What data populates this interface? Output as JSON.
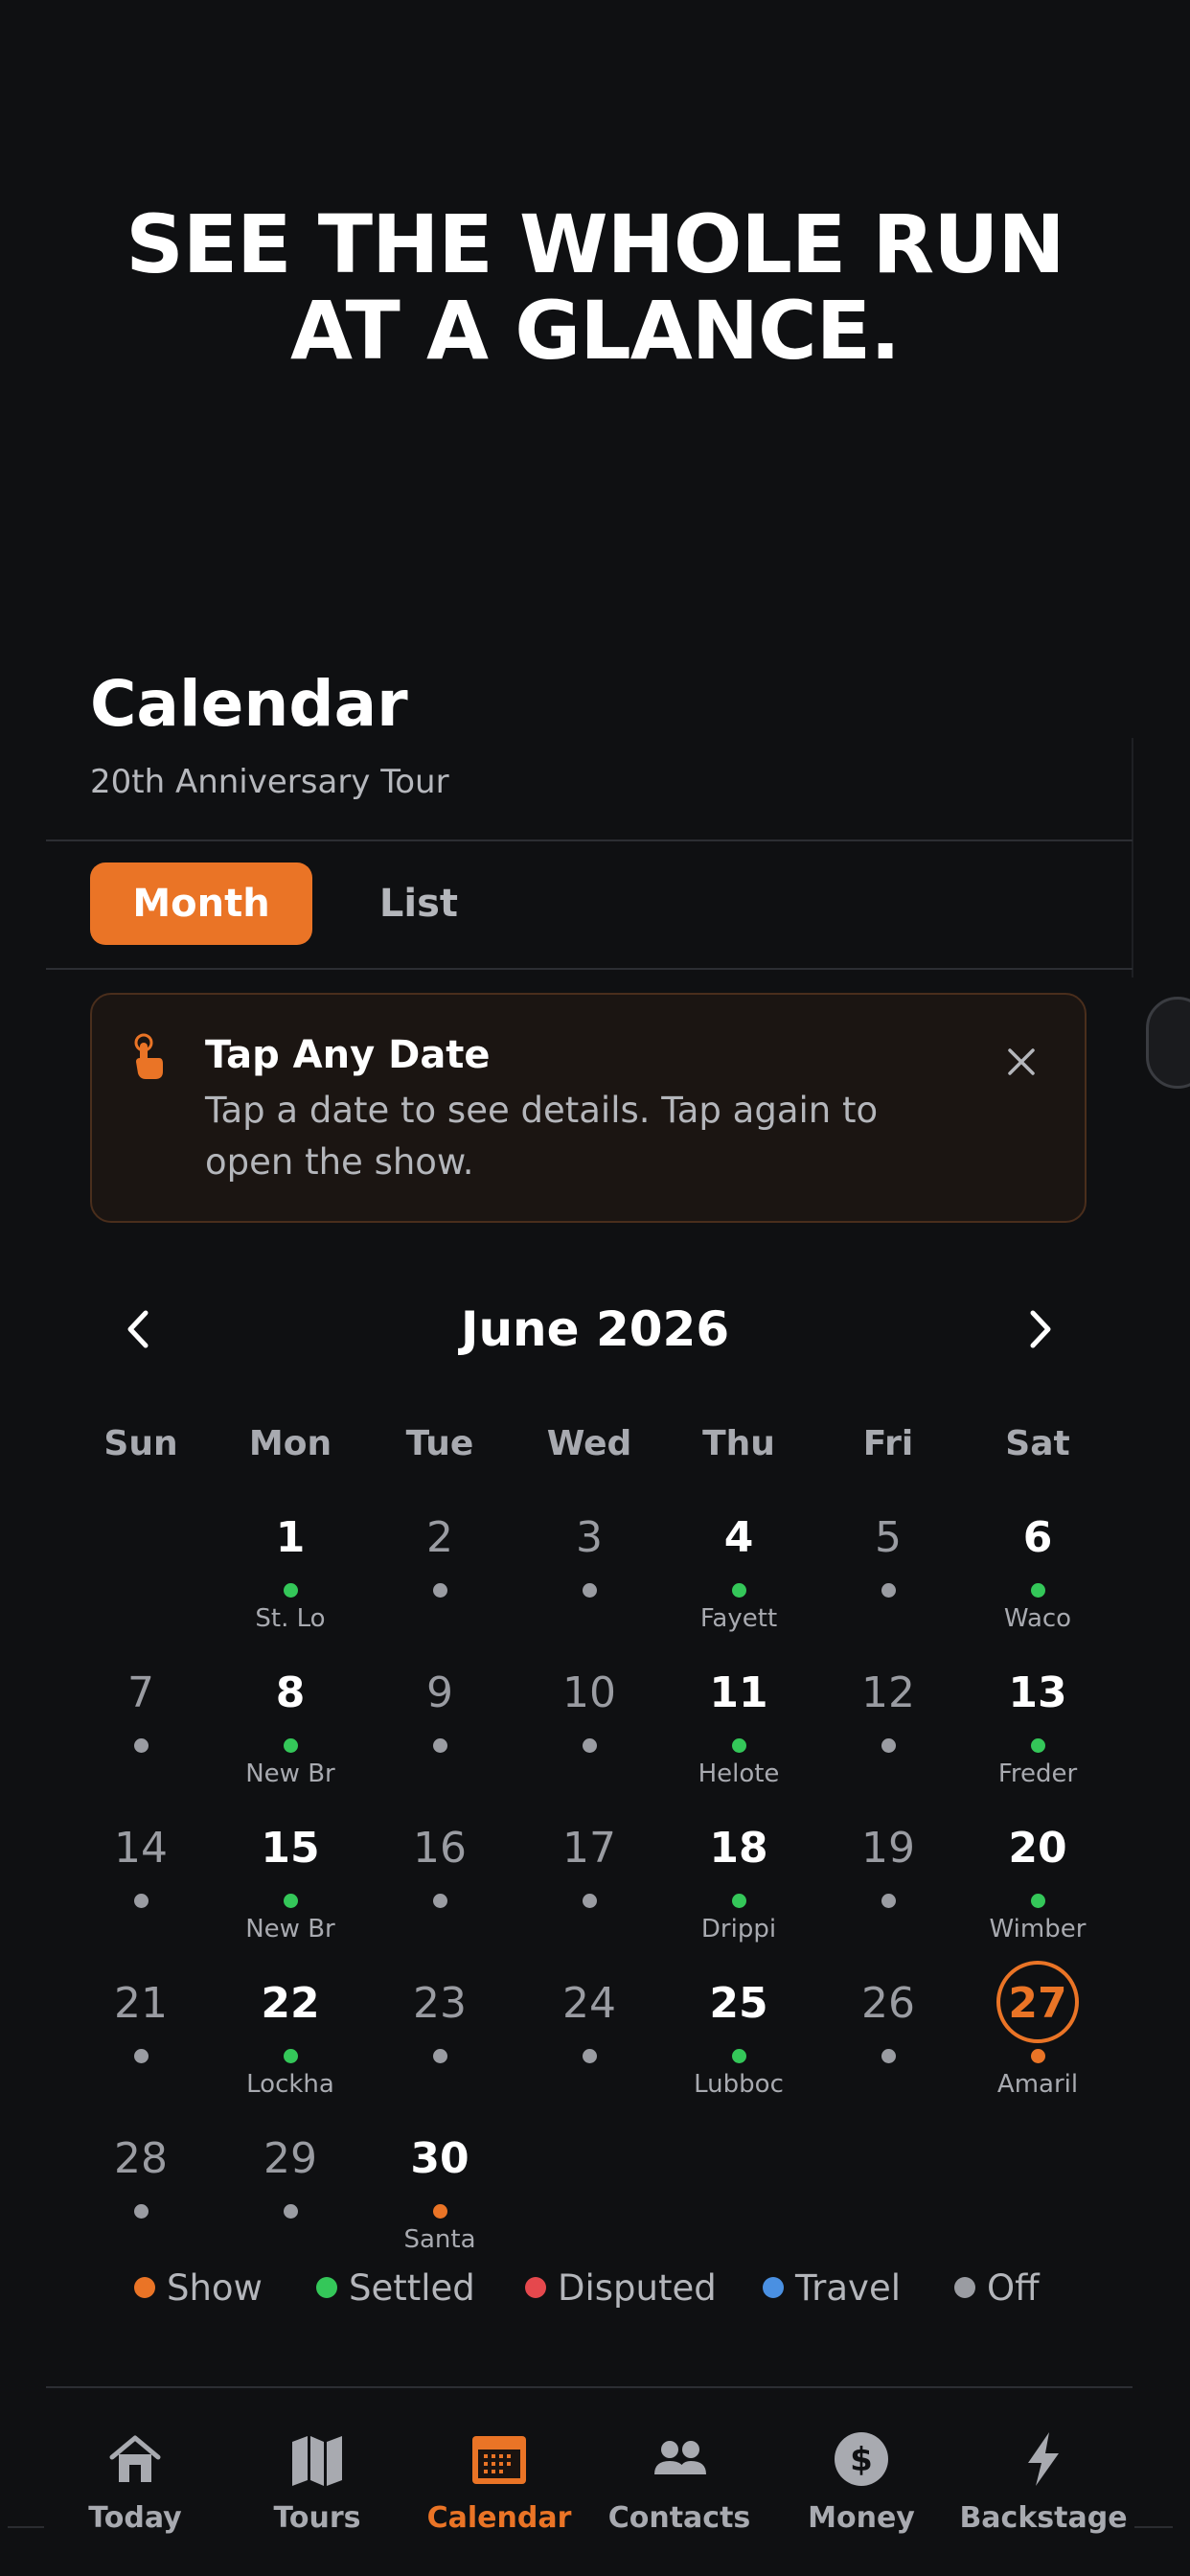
{
  "hero": {
    "line1": "SEE THE WHOLE RUN",
    "line2": "AT A GLANCE."
  },
  "calendar": {
    "title": "Calendar",
    "subtitle": "20th Anniversary Tour"
  },
  "view_toggle": {
    "month": "Month",
    "list": "List",
    "selected": "Month"
  },
  "tip": {
    "title": "Tap Any Date",
    "body": "Tap a date to see details. Tap again to open the show."
  },
  "month": {
    "label": "June 2026",
    "prev_icon": "chevron-left-icon",
    "next_icon": "chevron-right-icon"
  },
  "weekdays": [
    "Sun",
    "Mon",
    "Tue",
    "Wed",
    "Thu",
    "Fri",
    "Sat"
  ],
  "status_colors": {
    "show": "#ea7426",
    "settled": "#34c759",
    "disputed": "#e5484d",
    "travel": "#4a90e2",
    "off": "#9a9ca2"
  },
  "days": [
    {
      "d": "1",
      "status": "settled",
      "venue": "St. Lo"
    },
    {
      "d": "2",
      "status": "off",
      "venue": ""
    },
    {
      "d": "3",
      "status": "off",
      "venue": ""
    },
    {
      "d": "4",
      "status": "settled",
      "venue": "Fayett"
    },
    {
      "d": "5",
      "status": "off",
      "venue": ""
    },
    {
      "d": "6",
      "status": "settled",
      "venue": "Waco"
    },
    {
      "d": "7",
      "status": "off",
      "venue": ""
    },
    {
      "d": "8",
      "status": "settled",
      "venue": "New Br"
    },
    {
      "d": "9",
      "status": "off",
      "venue": ""
    },
    {
      "d": "10",
      "status": "off",
      "venue": ""
    },
    {
      "d": "11",
      "status": "settled",
      "venue": "Helote"
    },
    {
      "d": "12",
      "status": "off",
      "venue": ""
    },
    {
      "d": "13",
      "status": "settled",
      "venue": "Freder"
    },
    {
      "d": "14",
      "status": "off",
      "venue": ""
    },
    {
      "d": "15",
      "status": "settled",
      "venue": "New Br"
    },
    {
      "d": "16",
      "status": "off",
      "venue": ""
    },
    {
      "d": "17",
      "status": "off",
      "venue": ""
    },
    {
      "d": "18",
      "status": "settled",
      "venue": "Drippi"
    },
    {
      "d": "19",
      "status": "off",
      "venue": ""
    },
    {
      "d": "20",
      "status": "settled",
      "venue": "Wimber"
    },
    {
      "d": "21",
      "status": "off",
      "venue": ""
    },
    {
      "d": "22",
      "status": "settled",
      "venue": "Lockha"
    },
    {
      "d": "23",
      "status": "off",
      "venue": ""
    },
    {
      "d": "24",
      "status": "off",
      "venue": ""
    },
    {
      "d": "25",
      "status": "settled",
      "venue": "Lubboc"
    },
    {
      "d": "26",
      "status": "off",
      "venue": ""
    },
    {
      "d": "27",
      "status": "show",
      "venue": "Amaril",
      "today": true
    },
    {
      "d": "28",
      "status": "off",
      "venue": ""
    },
    {
      "d": "29",
      "status": "off",
      "venue": ""
    },
    {
      "d": "30",
      "status": "show",
      "venue": "Santa"
    }
  ],
  "first_weekday_index": 1,
  "legend": [
    {
      "label": "Show",
      "status": "show"
    },
    {
      "label": "Settled",
      "status": "settled"
    },
    {
      "label": "Disputed",
      "status": "disputed"
    },
    {
      "label": "Travel",
      "status": "travel"
    },
    {
      "label": "Off",
      "status": "off"
    }
  ],
  "tabs": [
    {
      "label": "Today",
      "icon": "house-icon",
      "active": false
    },
    {
      "label": "Tours",
      "icon": "map-icon",
      "active": false
    },
    {
      "label": "Calendar",
      "icon": "calendar-icon",
      "active": true
    },
    {
      "label": "Contacts",
      "icon": "people-icon",
      "active": false
    },
    {
      "label": "Money",
      "icon": "dollar-icon",
      "active": false
    },
    {
      "label": "Backstage",
      "icon": "lightning-icon",
      "active": false
    }
  ]
}
